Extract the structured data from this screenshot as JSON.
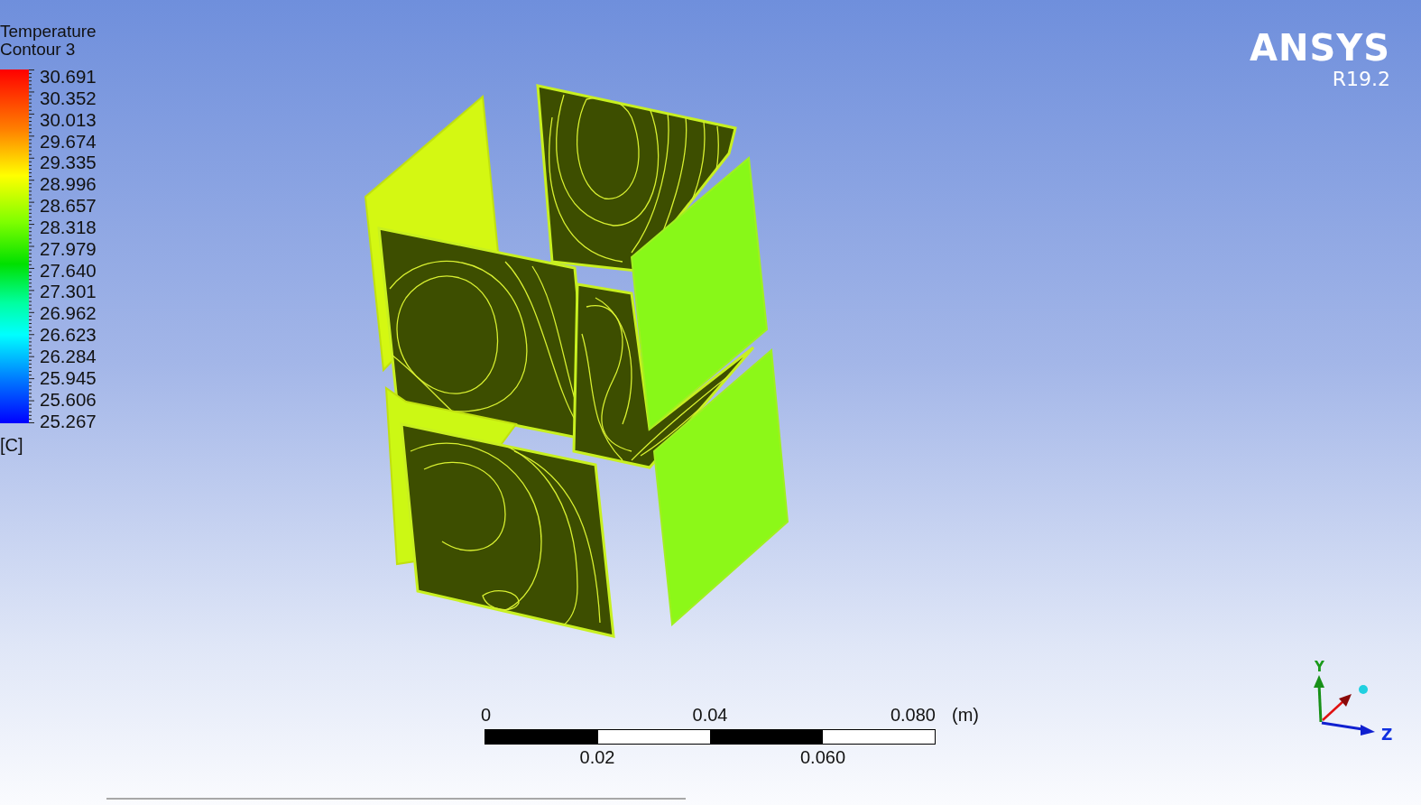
{
  "legend": {
    "title_lines": [
      "Temperature",
      "Contour 3"
    ],
    "values": [
      "30.691",
      "30.352",
      "30.013",
      "29.674",
      "29.335",
      "28.996",
      "28.657",
      "28.318",
      "27.979",
      "27.640",
      "27.301",
      "26.962",
      "26.623",
      "26.284",
      "25.945",
      "25.606",
      "25.267"
    ],
    "unit": "[C]"
  },
  "logo": {
    "brand": "ANSYS",
    "version": "R19.2"
  },
  "scale_bar": {
    "ticks": [
      "0",
      "0.02",
      "0.04",
      "0.060",
      "0.080"
    ],
    "unit": "(m)"
  },
  "axis_triad": {
    "y_label": "Y",
    "z_label": "Z"
  }
}
